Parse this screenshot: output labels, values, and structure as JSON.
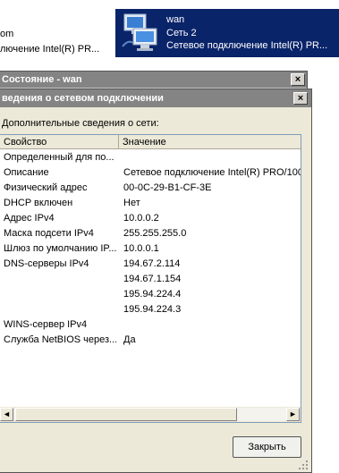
{
  "connections": {
    "left": {
      "line1": "om",
      "line2": "лючение Intel(R) PR..."
    },
    "selected": {
      "name": "wan",
      "network": "Сеть  2",
      "adapter": "Сетевое подключение Intel(R) PR..."
    }
  },
  "status_window": {
    "title": "Состояние - wan",
    "close": "×"
  },
  "details_dialog": {
    "title": "ведения о сетевом подключении",
    "close": "×",
    "label": "Дополнительные сведения о сети:",
    "columns": [
      "Свойство",
      "Значение"
    ],
    "rows": [
      {
        "prop": "Определенный для по...",
        "value": ""
      },
      {
        "prop": "Описание",
        "value": "Сетевое подключение Intel(R) PRO/100"
      },
      {
        "prop": "Физический адрес",
        "value": "00-0C-29-B1-CF-3E"
      },
      {
        "prop": "DHCP включен",
        "value": "Нет"
      },
      {
        "prop": "Адрес IPv4",
        "value": "10.0.0.2"
      },
      {
        "prop": "Маска подсети IPv4",
        "value": "255.255.255.0"
      },
      {
        "prop": "Шлюз по умолчанию IP...",
        "value": "10.0.0.1"
      },
      {
        "prop": "DNS-серверы IPv4",
        "value": "194.67.2.114"
      },
      {
        "prop": "",
        "value": "194.67.1.154"
      },
      {
        "prop": "",
        "value": "195.94.224.4"
      },
      {
        "prop": "",
        "value": "195.94.224.3"
      },
      {
        "prop": "WINS-сервер IPv4",
        "value": ""
      },
      {
        "prop": "Служба NetBIOS через...",
        "value": "Да"
      }
    ],
    "scroll_left": "◄",
    "scroll_right": "►",
    "close_button": "Закрыть"
  }
}
